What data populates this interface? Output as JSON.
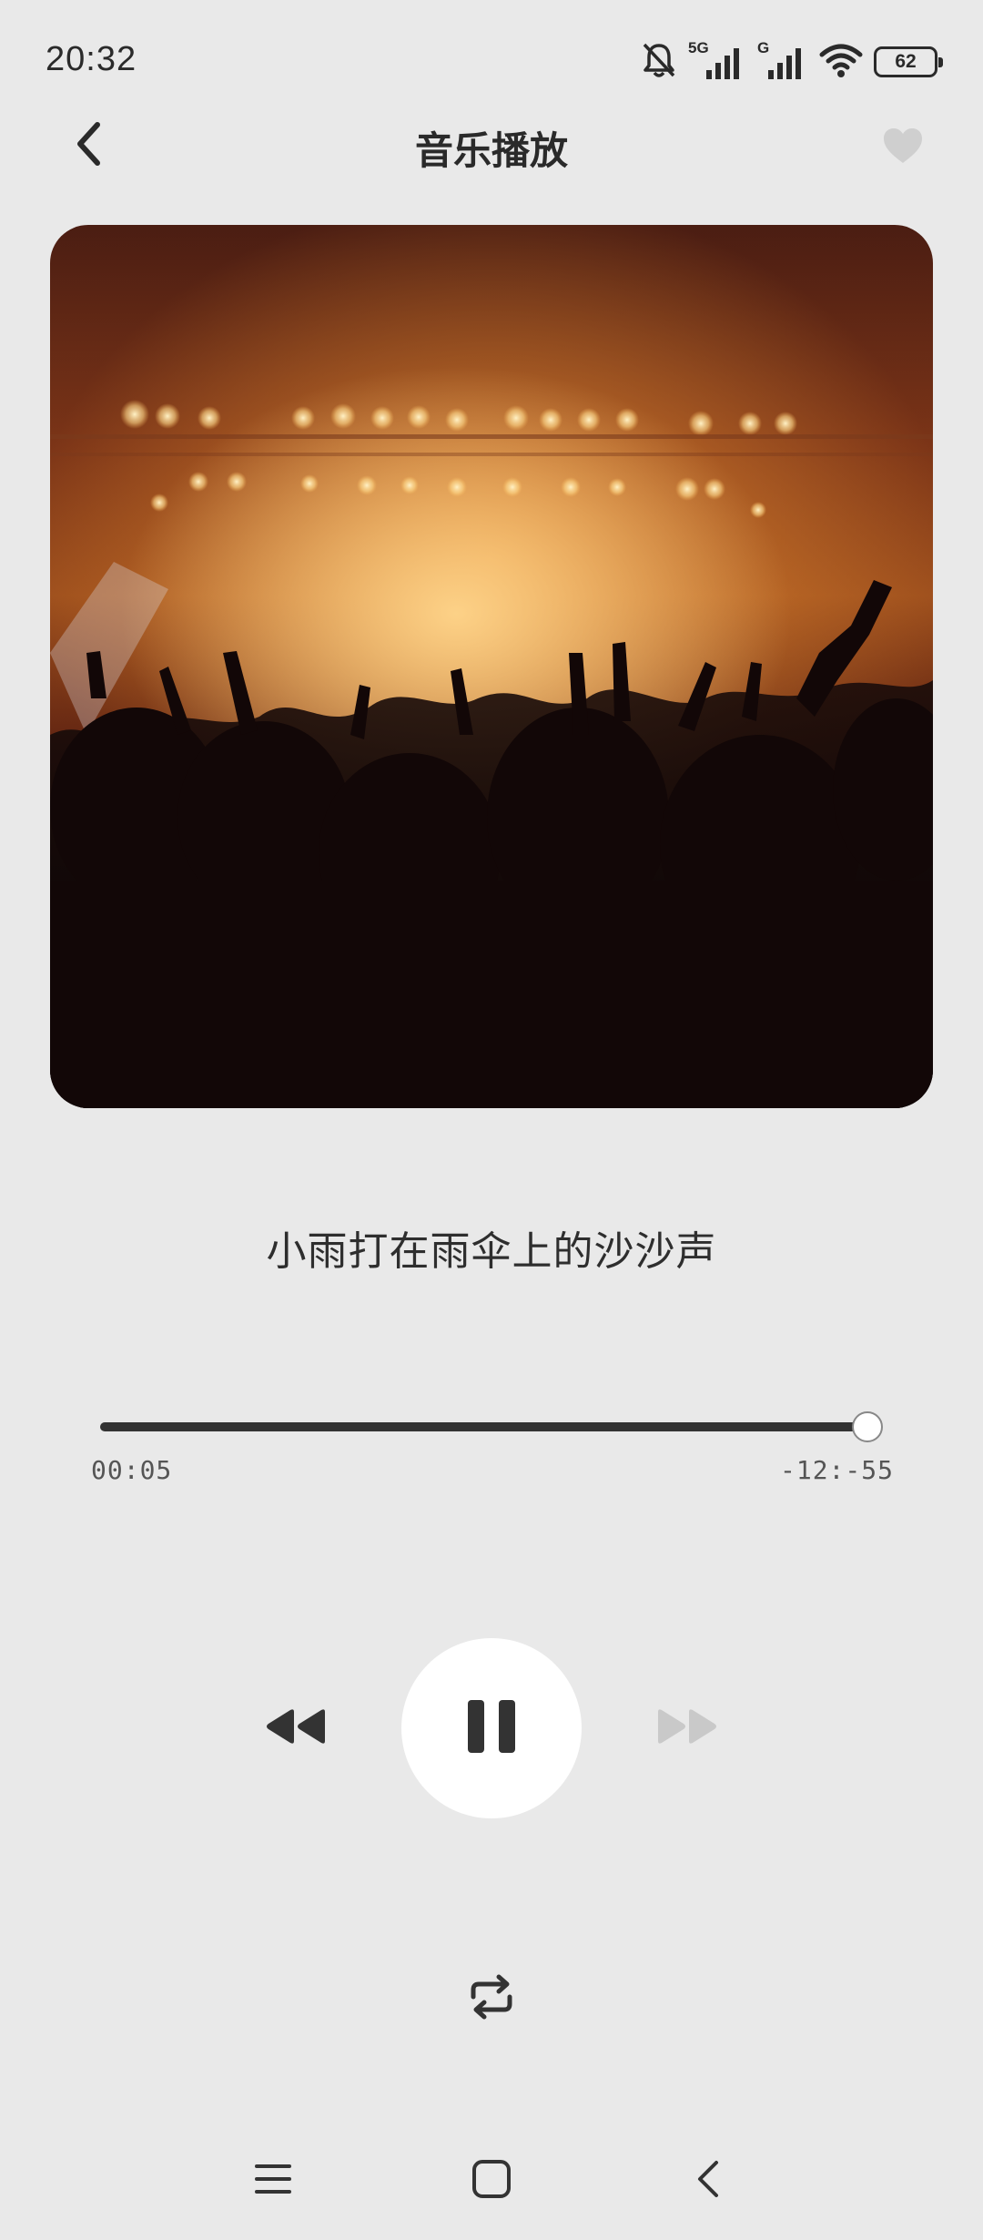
{
  "status_bar": {
    "time": "20:32",
    "signal_5g_label": "5G",
    "signal_g_label": "G",
    "battery_level": "62"
  },
  "header": {
    "title": "音乐播放"
  },
  "track": {
    "title": "小雨打在雨伞上的沙沙声"
  },
  "progress": {
    "elapsed": "00:05",
    "remaining": "-12:-55",
    "fraction": 1.0
  },
  "controls": {
    "prev": "rewind-icon",
    "play_state": "playing",
    "next": "fast-forward-icon",
    "next_enabled": false,
    "repeat": "repeat-icon"
  },
  "colors": {
    "background": "#e9e9e9",
    "accent": "#333333",
    "disabled": "#c9c9c9"
  },
  "navigation": {
    "menu": "menu-icon",
    "home": "home-icon",
    "back": "back-icon"
  }
}
